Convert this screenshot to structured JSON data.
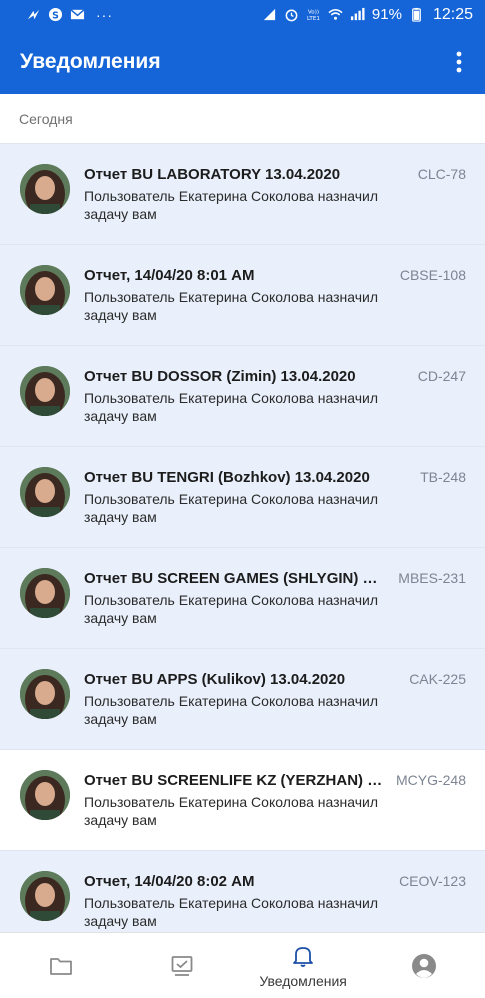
{
  "status_bar": {
    "battery_percent": "91%",
    "time": "12:25",
    "network_label": "Vo)) LTE1",
    "more_dots": "···"
  },
  "app_bar": {
    "title": "Уведомления"
  },
  "section": {
    "label": "Сегодня"
  },
  "notifications": [
    {
      "title": "Отчет BU LABORATORY 13.04.2020",
      "key": "CLC-78",
      "body": "Пользователь Екатерина Соколова назначил задачу вам",
      "read": false
    },
    {
      "title": "Отчет, 14/04/20 8:01 AM",
      "key": "CBSE-108",
      "body": "Пользователь Екатерина Соколова назначил задачу вам",
      "read": false
    },
    {
      "title": "Отчет BU DOSSOR (Zimin) 13.04.2020",
      "key": "CD-247",
      "body": "Пользователь Екатерина Соколова назначил задачу вам",
      "read": false
    },
    {
      "title": "Отчет BU TENGRI (Bozhkov) 13.04.2020",
      "key": "TB-248",
      "body": "Пользователь Екатерина Соколова назначил задачу вам",
      "read": false
    },
    {
      "title": "Отчет BU SCREEN GAMES (SHLYGIN) 13...",
      "key": "MBES-231",
      "body": "Пользователь Екатерина Соколова назначил задачу вам",
      "read": false
    },
    {
      "title": "Отчет BU APPS (Kulikov) 13.04.2020",
      "key": "CAK-225",
      "body": "Пользователь Екатерина Соколова назначил задачу вам",
      "read": false
    },
    {
      "title": "Отчет BU SCREENLIFE KZ (YERZHAN) 1...",
      "key": "MCYG-248",
      "body": "Пользователь Екатерина Соколова назначил задачу вам",
      "read": true
    },
    {
      "title": "Отчет, 14/04/20 8:02 AM",
      "key": "CEOV-123",
      "body": "Пользователь Екатерина Соколова назначил задачу вам",
      "read": false
    }
  ],
  "bottom_nav": {
    "notifications_label": "Уведомления",
    "items": [
      "folder-icon",
      "board-icon",
      "bell-icon",
      "profile-icon"
    ]
  },
  "colors": {
    "primary": "#1565d8",
    "unread_bg": "#e9f0fb",
    "read_bg": "#ffffff"
  }
}
